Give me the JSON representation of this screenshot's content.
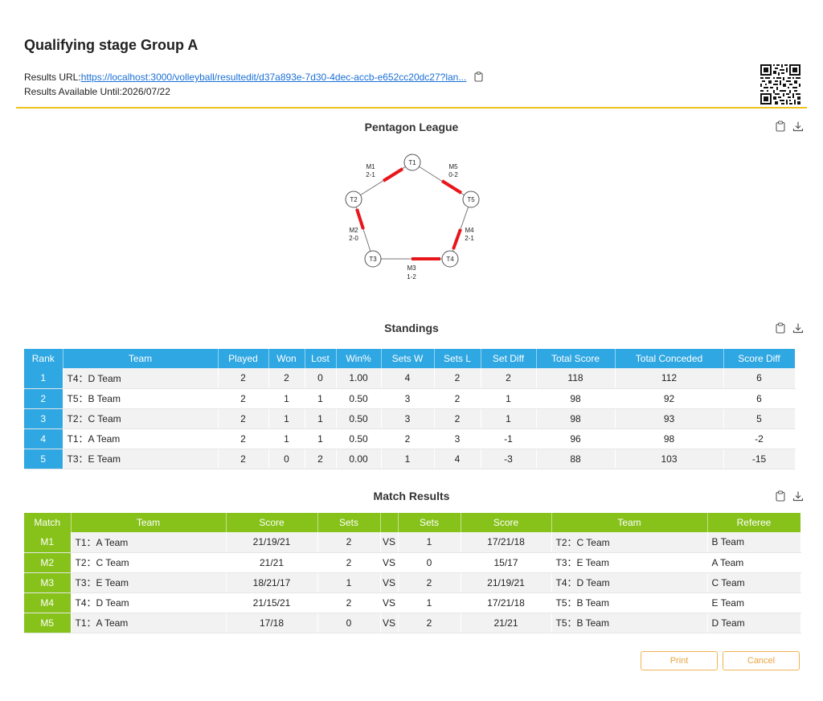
{
  "header": {
    "title": "Qualifying stage Group A",
    "results_url_label": "Results URL:",
    "results_url": "https://localhost:3000/volleyball/resultedit/d37a893e-7d30-4dec-accb-e652cc20dc27?lan...",
    "available_text": "Results Available Until:2026/07/22"
  },
  "league": {
    "title": "Pentagon League",
    "teams": [
      "T1",
      "T2",
      "T3",
      "T4",
      "T5"
    ],
    "matches": [
      {
        "id": "M1",
        "score": "2-1"
      },
      {
        "id": "M2",
        "score": "2-0"
      },
      {
        "id": "M3",
        "score": "1-2"
      },
      {
        "id": "M4",
        "score": "2-1"
      },
      {
        "id": "M5",
        "score": "0-2"
      }
    ]
  },
  "standings": {
    "title": "Standings",
    "headers": [
      "Rank",
      "Team",
      "Played",
      "Won",
      "Lost",
      "Win%",
      "Sets W",
      "Sets L",
      "Set Diff",
      "Total Score",
      "Total Conceded",
      "Score Diff"
    ],
    "rows": [
      [
        "1",
        "T4：D Team",
        "2",
        "2",
        "0",
        "1.00",
        "4",
        "2",
        "2",
        "118",
        "112",
        "6"
      ],
      [
        "2",
        "T5：B Team",
        "2",
        "1",
        "1",
        "0.50",
        "3",
        "2",
        "1",
        "98",
        "92",
        "6"
      ],
      [
        "3",
        "T2：C Team",
        "2",
        "1",
        "1",
        "0.50",
        "3",
        "2",
        "1",
        "98",
        "93",
        "5"
      ],
      [
        "4",
        "T1：A Team",
        "2",
        "1",
        "1",
        "0.50",
        "2",
        "3",
        "-1",
        "96",
        "98",
        "-2"
      ],
      [
        "5",
        "T3：E Team",
        "2",
        "0",
        "2",
        "0.00",
        "1",
        "4",
        "-3",
        "88",
        "103",
        "-15"
      ]
    ]
  },
  "match_results": {
    "title": "Match Results",
    "headers": [
      "Match",
      "Team",
      "Score",
      "Sets",
      "",
      "Sets",
      "Score",
      "Team",
      "Referee"
    ],
    "rows": [
      [
        "M1",
        "T1：A Team",
        "21/19/21",
        "2",
        "VS",
        "1",
        "17/21/18",
        "T2：C Team",
        "B Team"
      ],
      [
        "M2",
        "T2：C Team",
        "21/21",
        "2",
        "VS",
        "0",
        "15/17",
        "T3：E Team",
        "A Team"
      ],
      [
        "M3",
        "T3：E Team",
        "18/21/17",
        "1",
        "VS",
        "2",
        "21/19/21",
        "T4：D Team",
        "C Team"
      ],
      [
        "M4",
        "T4：D Team",
        "21/15/21",
        "2",
        "VS",
        "1",
        "17/21/18",
        "T5：B Team",
        "E Team"
      ],
      [
        "M5",
        "T1：A Team",
        "17/18",
        "0",
        "VS",
        "2",
        "21/21",
        "T5：B Team",
        "D Team"
      ]
    ]
  },
  "buttons": {
    "print": "Print",
    "cancel": "Cancel"
  },
  "colors": {
    "standings_accent": "#2ea7e2",
    "matches_accent": "#86c21a",
    "winner_line": "#e8161b",
    "divider": "#f0c01e",
    "button": "#e9a33d"
  },
  "icons": [
    "clipboard-icon",
    "download-icon",
    "qr-code"
  ]
}
